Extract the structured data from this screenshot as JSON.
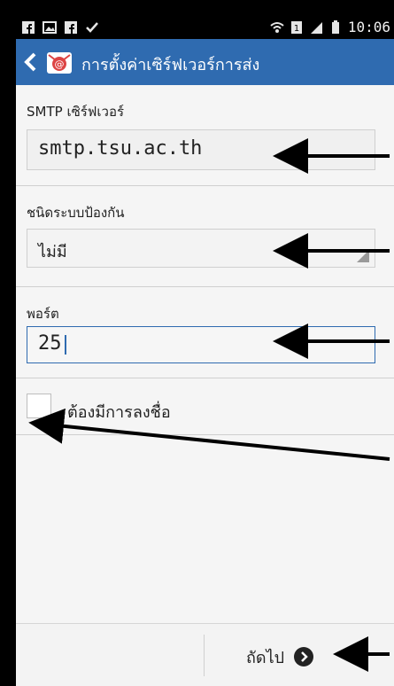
{
  "statusbar": {
    "time": "10:06",
    "icons_left": [
      "f-icon",
      "image-icon",
      "f-icon",
      "check-icon"
    ],
    "icons_right": [
      "wifi-icon",
      "sim-icon",
      "signal-icon",
      "battery-icon"
    ]
  },
  "actionbar": {
    "title": "การตั้งค่าเซิร์ฟเวอร์การส่ง",
    "accent": "#2f6bb0"
  },
  "smtp": {
    "label": "SMTP เซิร์ฟเวอร์",
    "value": "smtp.tsu.ac.th"
  },
  "security": {
    "label": "ชนิดระบบป้องกัน",
    "value": "ไม่มี"
  },
  "port": {
    "label": "พอร์ต",
    "value": "25"
  },
  "signin": {
    "label": "ต้องมีการลงชื่อ"
  },
  "footer": {
    "next_label": "ถัดไป"
  }
}
